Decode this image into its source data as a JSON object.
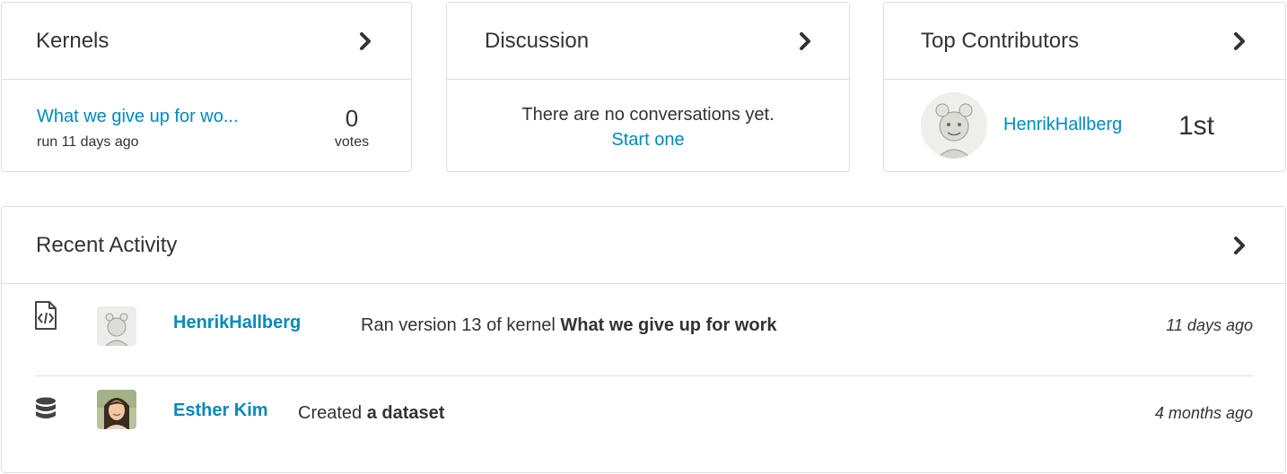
{
  "kernels": {
    "title": "Kernels",
    "item": {
      "name": "What we give up for wo...",
      "meta": "run 11 days ago",
      "votes": "0",
      "votes_label": "votes"
    }
  },
  "discussion": {
    "title": "Discussion",
    "empty_text": "There are no conversations yet.",
    "start_link": "Start one"
  },
  "contributors": {
    "title": "Top Contributors",
    "top": {
      "name": "HenrikHallberg",
      "rank": "1st"
    }
  },
  "activity": {
    "title": "Recent Activity",
    "items": [
      {
        "icon": "code-file-icon",
        "user": "HenrikHallberg",
        "action": "Ran version 13 of kernel ",
        "target": "What we give up for work",
        "time": "11 days ago"
      },
      {
        "icon": "database-icon",
        "user": "Esther Kim",
        "action": "Created ",
        "target": "a dataset",
        "time": "4 months ago"
      }
    ]
  },
  "colors": {
    "link": "#008abc",
    "text": "#333333",
    "border": "#dedfe0"
  }
}
